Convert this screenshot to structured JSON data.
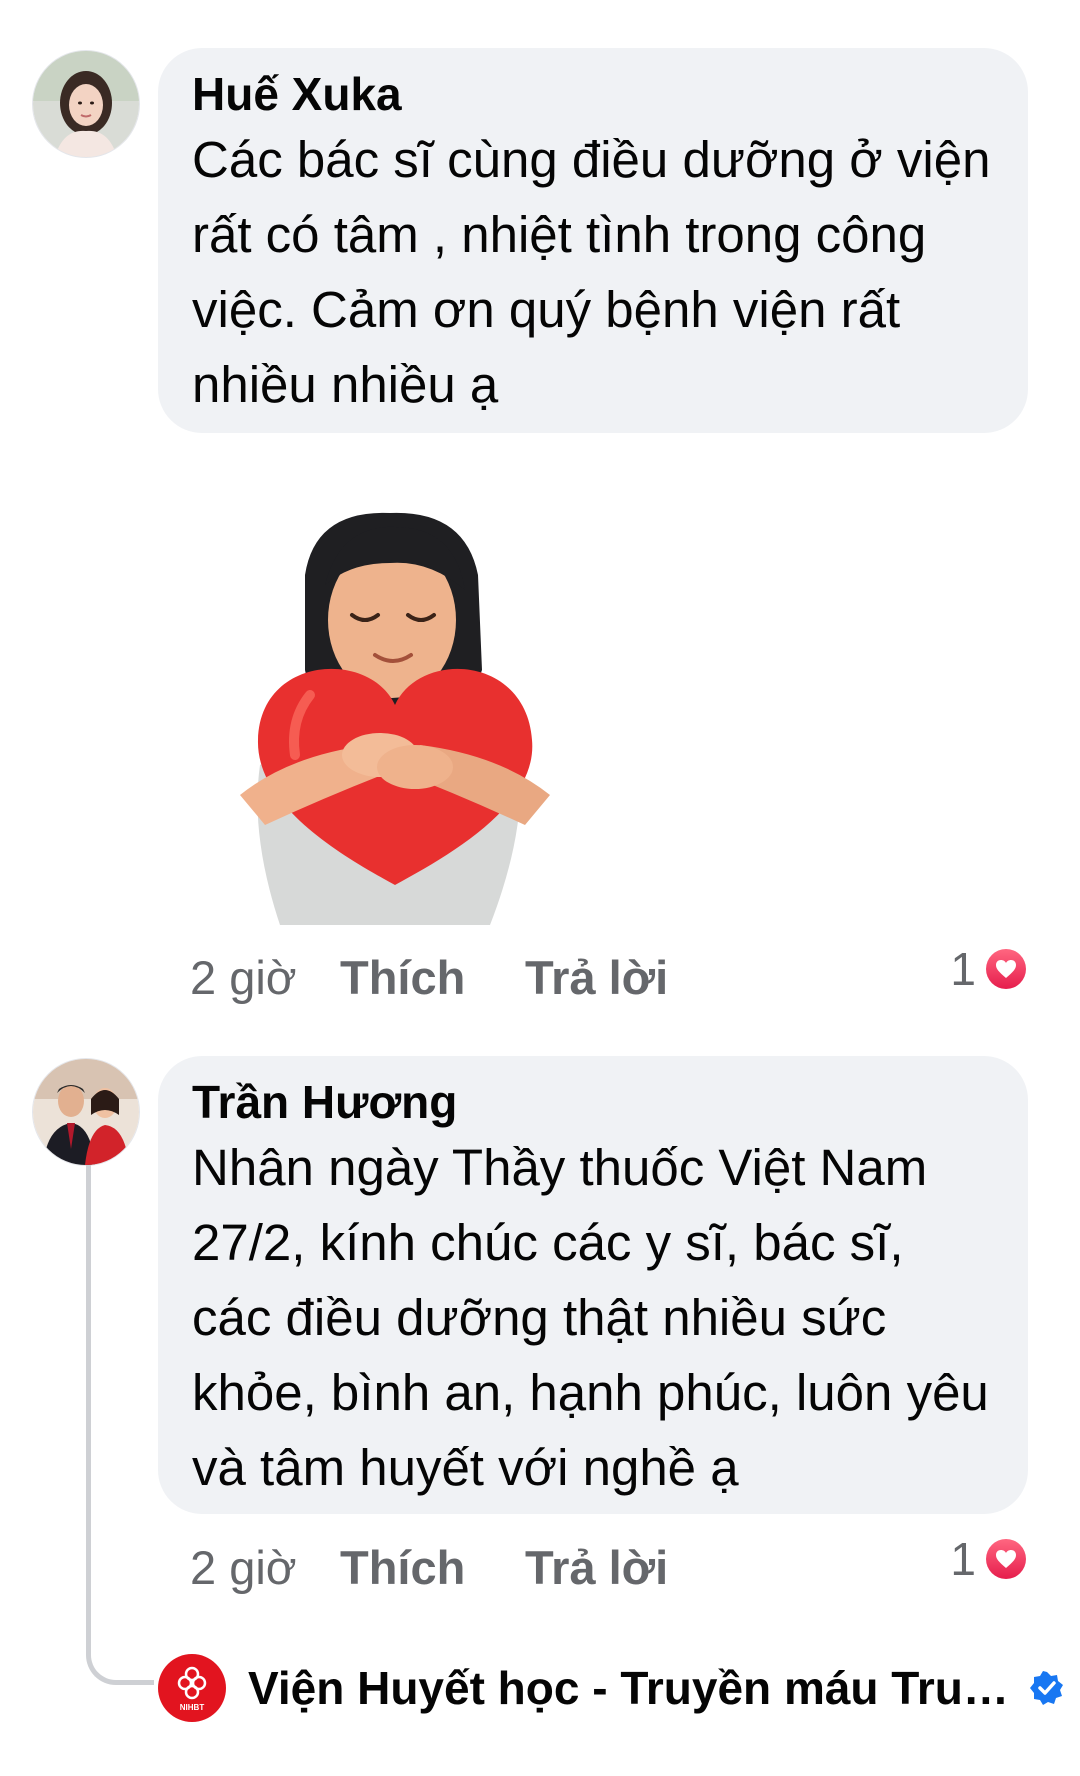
{
  "comments": [
    {
      "author": "Huế Xuka",
      "text": "Các bác sĩ cùng điều dưỡng ở viện rất có tâm , nhiệt tình trong công việc. Cảm ơn quý bệnh viện rất nhiều nhiều ạ",
      "time": "2 giờ",
      "like_label": "Thích",
      "reply_label": "Trả lời",
      "reaction_count": "1",
      "reaction_icon": "heart-icon",
      "has_sticker": true
    },
    {
      "author": "Trần Hương",
      "text": "Nhân ngày Thầy thuốc Việt Nam 27/2, kính chúc các y sĩ, bác sĩ, các điều dưỡng thật nhiều sức khỏe, bình an, hạnh phúc, luôn yêu và tâm huyết với nghề ạ",
      "time": "2 giờ",
      "like_label": "Thích",
      "reply_label": "Trả lời",
      "reaction_count": "1",
      "reaction_icon": "heart-icon"
    }
  ],
  "reply_preview": {
    "author": "Viện Huyết học - Truyền máu Trun...",
    "logo_text": "NIHBT",
    "verified": true
  },
  "colors": {
    "bubble": "#f0f2f5",
    "secondary_text": "#65676b",
    "heart": "#e61e4d",
    "verified": "#1877f2",
    "page_logo": "#e2141f"
  }
}
